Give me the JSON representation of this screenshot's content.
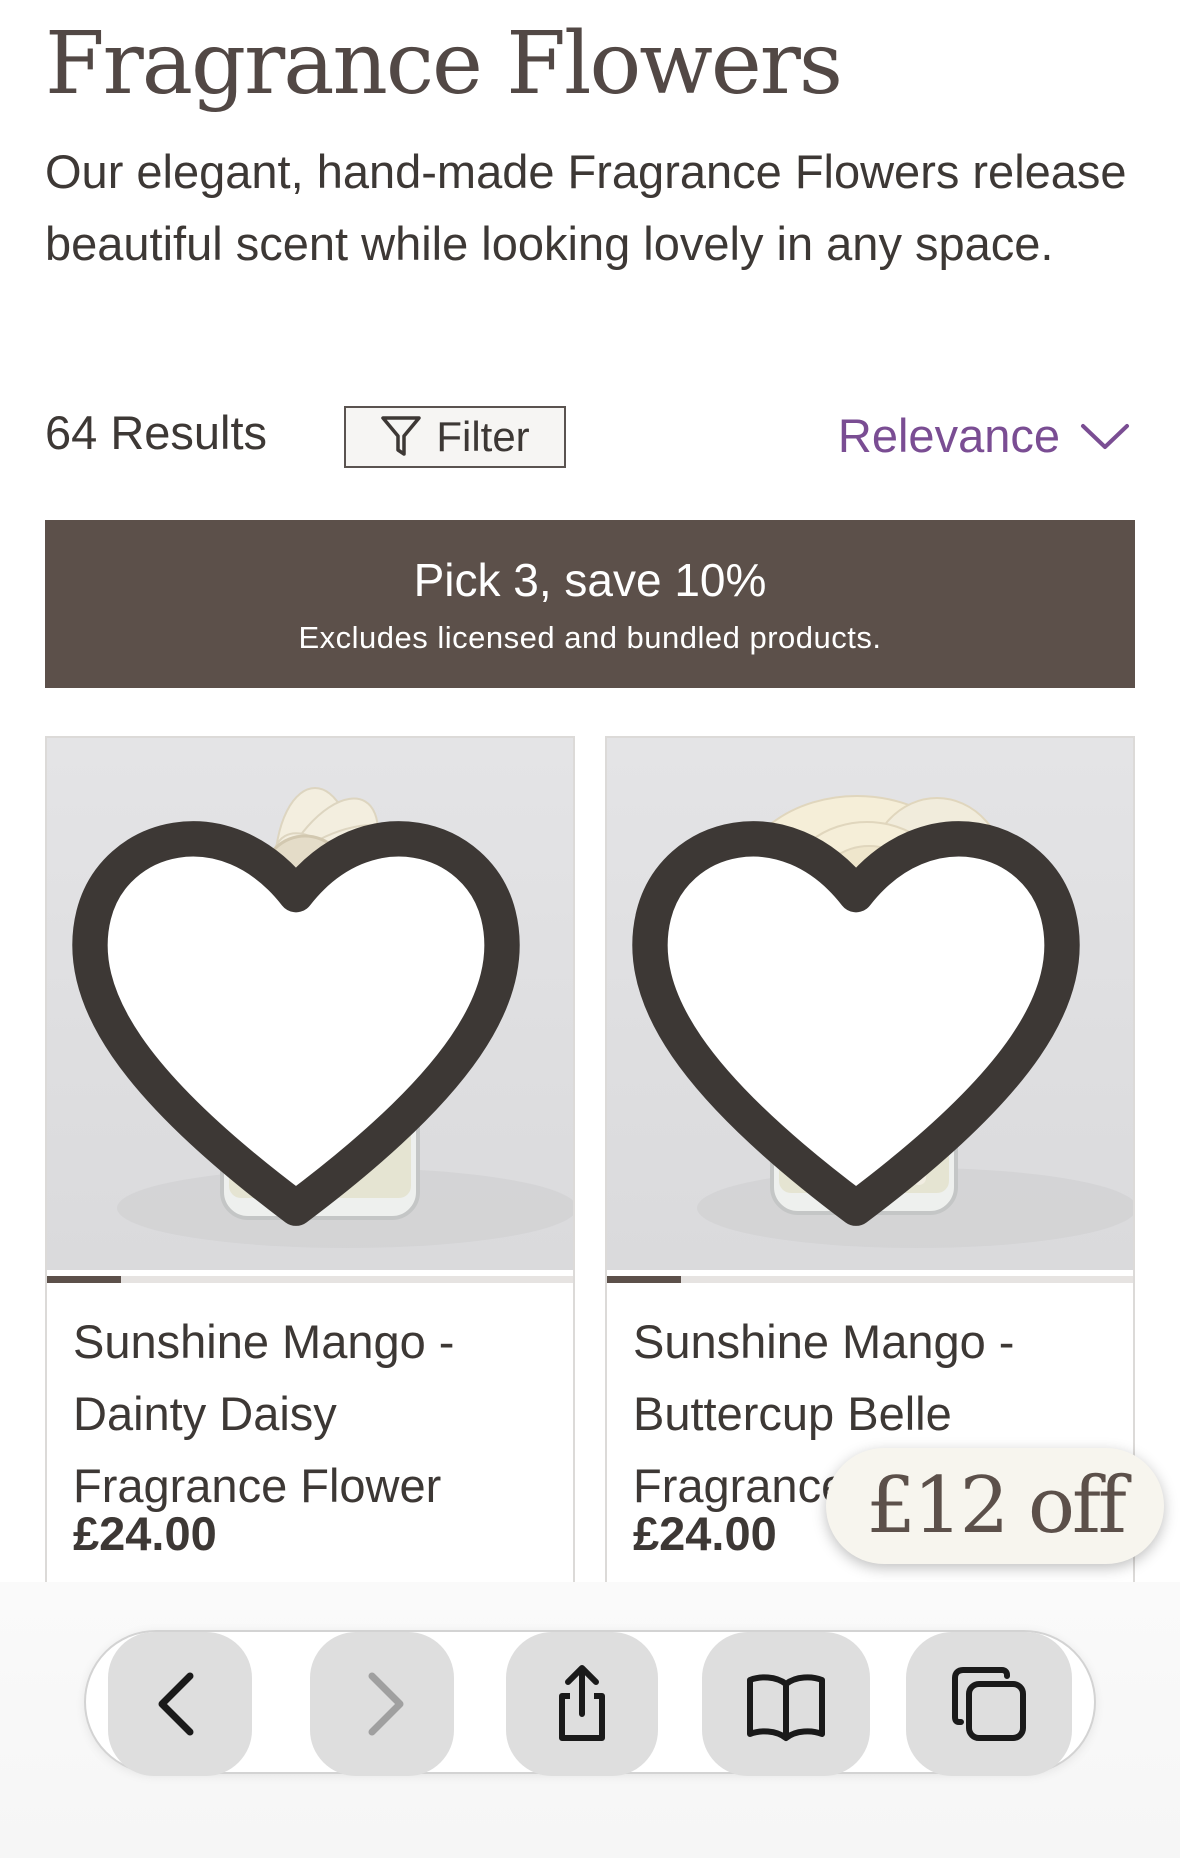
{
  "page": {
    "title": "Fragrance Flowers",
    "intro": "Our elegant, hand-made Fragrance Flowers release beautiful scent while looking lovely in any space."
  },
  "toolbar_filters": {
    "results_label": "64 Results",
    "filter_label": "Filter",
    "sort_label": "Relevance"
  },
  "promo": {
    "title": "Pick 3, save 10%",
    "subtitle": "Excludes licensed and bundled products."
  },
  "products": [
    {
      "name": "Sunshine Mango - Dainty Daisy Fragrance Flower",
      "price": "£24.00",
      "image_icon": "daisy-fragrance-flower-image",
      "image_progress": 0.14
    },
    {
      "name": "Sunshine Mango - Buttercup Belle Fragrance Flower",
      "price": "£24.00",
      "image_icon": "buttercup-fragrance-flower-image",
      "image_progress": 0.14
    }
  ],
  "badge": {
    "label": "£12 off"
  },
  "browser_toolbar": {
    "buttons": [
      "back-icon",
      "forward-icon",
      "share-icon",
      "bookmarks-icon",
      "tabs-icon"
    ]
  },
  "colors": {
    "accent_purple": "#7a4d93",
    "promo_bg": "#5c504a",
    "text": "#3d3835"
  }
}
